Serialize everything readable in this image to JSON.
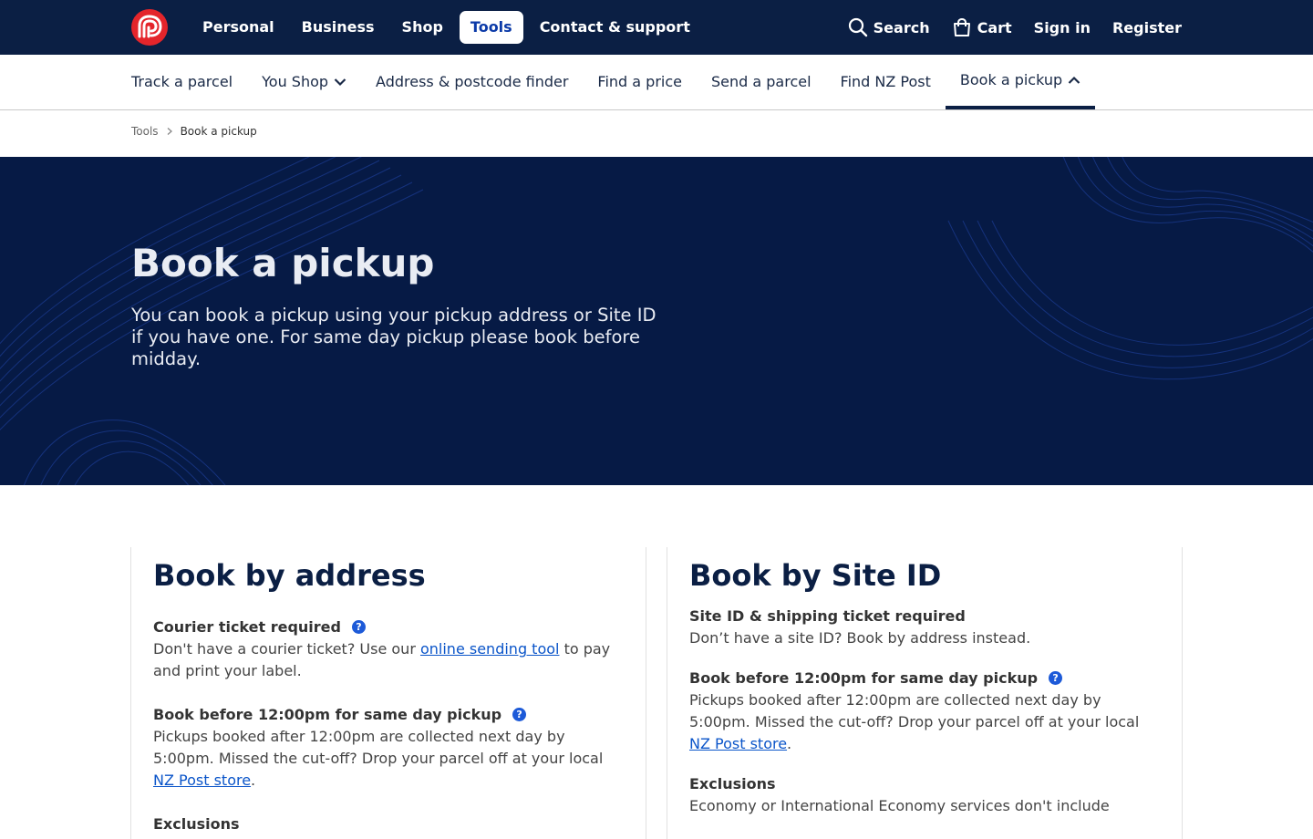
{
  "topnav": {
    "items": [
      "Personal",
      "Business",
      "Shop",
      "Tools",
      "Contact & support"
    ],
    "active": "Tools",
    "search_label": "Search",
    "cart_label": "Cart",
    "signin_label": "Sign in",
    "register_label": "Register"
  },
  "subnav": {
    "items": [
      "Track a parcel",
      "You Shop",
      "Address & postcode finder",
      "Find a price",
      "Send a parcel",
      "Find NZ Post",
      "Book a pickup"
    ],
    "active": "Book a pickup"
  },
  "breadcrumb": {
    "parent": "Tools",
    "current": "Book a pickup"
  },
  "hero": {
    "title": "Book a pickup",
    "description": "You can book a pickup using your pickup address or Site ID if you have one. For same day pickup please book before midday."
  },
  "address_card": {
    "title": "Book by address",
    "ticket_title": "Courier ticket required",
    "ticket_text_before": "Don't have a courier ticket? Use our ",
    "ticket_link": "online sending tool",
    "ticket_text_after": " to pay and print your label.",
    "cutoff_title": "Book before 12:00pm for same day pickup",
    "cutoff_text_before": "Pickups booked after 12:00pm are collected next day by 5:00pm. Missed the cut-off? Drop your parcel off at your local ",
    "cutoff_link": "NZ Post store",
    "cutoff_text_after": ".",
    "exclusions_title": "Exclusions"
  },
  "siteid_card": {
    "title": "Book by Site ID",
    "siteid_title": "Site ID & shipping ticket required",
    "siteid_text": "Don’t have a site ID? Book by address instead.",
    "cutoff_title": "Book before 12:00pm for same day pickup",
    "cutoff_text_before": "Pickups booked after 12:00pm are collected next day by 5:00pm. Missed the cut-off? Drop your parcel off at your local ",
    "cutoff_link": "NZ Post store",
    "cutoff_text_after": ".",
    "exclusions_title": "Exclusions",
    "exclusions_text": "Economy or International Economy services don't include"
  },
  "help_glyph": "?",
  "colors": {
    "navy": "#0b1f44",
    "hero": "#061a45",
    "brand_red": "#e4252b",
    "link": "#0b55c9",
    "help_blue": "#1d5ad8"
  }
}
